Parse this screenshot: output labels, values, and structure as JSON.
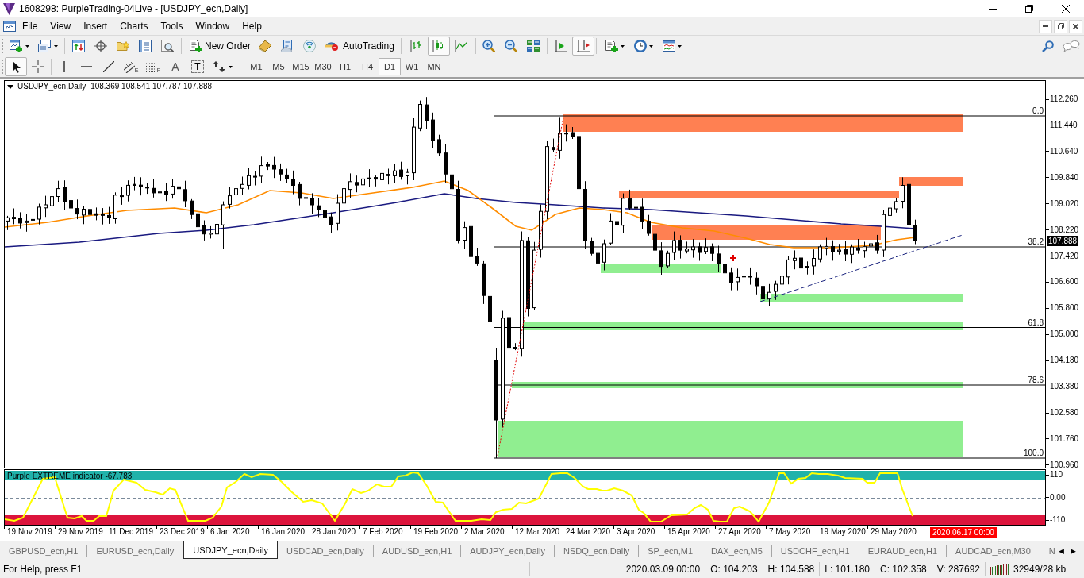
{
  "window": {
    "title": "1608298: PurpleTrading-04Live - [USDJPY_ecn,Daily]"
  },
  "menu": [
    "File",
    "View",
    "Insert",
    "Charts",
    "Tools",
    "Window",
    "Help"
  ],
  "toolbar": {
    "new_order": "New Order",
    "auto_trading": "AutoTrading",
    "chart_types": [
      {
        "selected": false
      },
      {
        "selected": true
      },
      {
        "selected": false
      }
    ],
    "auto_scroll": {
      "on": false
    },
    "chart_shift": {
      "on": true
    }
  },
  "drawing_toolbar": {
    "pointers": [
      {
        "selected": true
      },
      {
        "selected": false
      }
    ],
    "channel_tool": "E",
    "fibonacci_tool": "F",
    "text_tool": "A",
    "label_tool": "T",
    "timeframes": [
      {
        "label": "M1",
        "selected": false
      },
      {
        "label": "M5",
        "selected": false
      },
      {
        "label": "M15",
        "selected": false
      },
      {
        "label": "M30",
        "selected": false
      },
      {
        "label": "H1",
        "selected": false
      },
      {
        "label": "H4",
        "selected": false
      },
      {
        "label": "D1",
        "selected": true
      },
      {
        "label": "W1",
        "selected": false
      },
      {
        "label": "MN",
        "selected": false
      }
    ]
  },
  "chart": {
    "symbol": "USDJPY_ecn,Daily",
    "ohlc": "108.369 108.541 107.787 107.888",
    "price_axis": [
      "112.260",
      "111.440",
      "110.640",
      "109.840",
      "109.020",
      "108.220",
      "107.420",
      "106.600",
      "105.800",
      "105.000",
      "104.180",
      "103.380",
      "102.580",
      "101.760",
      "100.960"
    ],
    "current_price": "107.888",
    "fibonacci_levels": [
      "0.0",
      "38.2",
      "61.8",
      "78.6",
      "100.0"
    ],
    "indicator": {
      "label": "Purple EXTREME indicator -67.783",
      "axis": [
        "110",
        "0.00",
        "-110"
      ]
    },
    "time_axis": [
      "19 Nov 2019",
      "29 Nov 2019",
      "11 Dec 2019",
      "23 Dec 2019",
      "6 Jan 2020",
      "16 Jan 2020",
      "28 Jan 2020",
      "7 Feb 2020",
      "19 Feb 2020",
      "2 Mar 2020",
      "12 Mar 2020",
      "24 Mar 2020",
      "3 Apr 2020",
      "15 Apr 2020",
      "27 Apr 2020",
      "7 May 2020",
      "19 May 2020",
      "29 May 2020"
    ],
    "cursor_time": "2020.06.17 00:00"
  },
  "tabs": [
    {
      "label": "GBPUSD_ecn,H1",
      "selected": false
    },
    {
      "label": "EURUSD_ecn,Daily",
      "selected": false
    },
    {
      "label": "USDJPY_ecn,Daily",
      "selected": true
    },
    {
      "label": "USDCAD_ecn,Daily",
      "selected": false
    },
    {
      "label": "AUDUSD_ecn,H1",
      "selected": false
    },
    {
      "label": "AUDJPY_ecn,Daily",
      "selected": false
    },
    {
      "label": "NSDQ_ecn,Daily",
      "selected": false
    },
    {
      "label": "SP_ecn,M1",
      "selected": false
    },
    {
      "label": "DAX_ecn,M5",
      "selected": false
    },
    {
      "label": "USDCHF_ecn,H1",
      "selected": false
    },
    {
      "label": "EURAUD_ecn,H1",
      "selected": false
    },
    {
      "label": "AUDCAD_ecn,M30",
      "selected": false
    },
    {
      "label": "N",
      "selected": false
    }
  ],
  "tab_scroll": [
    "◀",
    "▶"
  ],
  "status_bar": {
    "help": "For Help, press F1",
    "fields": [
      "2020.03.09 00:00",
      "O: 104.203",
      "H: 104.588",
      "L: 101.180",
      "C: 102.358",
      "V: 287692"
    ],
    "traffic": "32949/28 kb"
  }
}
